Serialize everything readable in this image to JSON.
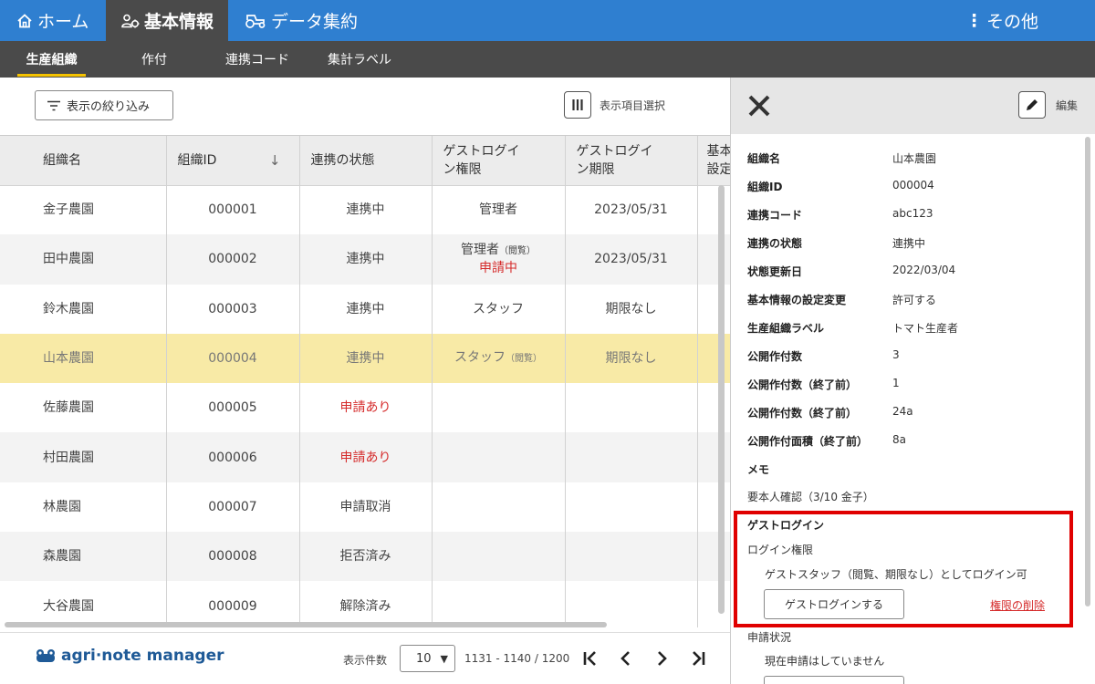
{
  "nav": {
    "home": "ホーム",
    "basic_info": "基本情報",
    "data_aggregation": "データ集約",
    "more": "その他"
  },
  "subnav": {
    "items": [
      "生産組織",
      "作付",
      "連携コード",
      "集計ラベル"
    ],
    "active_index": 0
  },
  "toolbar": {
    "filter_label": "表示の絞り込み",
    "column_select_label": "表示項目選択"
  },
  "table": {
    "headers": [
      "組織名",
      "組織ID",
      "連携の状態",
      "ゲストログイン権限",
      "ゲストログイン期限",
      "基本情報の設定"
    ],
    "header_lines": [
      [
        "組織名"
      ],
      [
        "組織ID"
      ],
      [
        "連携の状態"
      ],
      [
        "ゲストログイ",
        "ン権限"
      ],
      [
        "ゲストログイ",
        "ン期限"
      ],
      [
        "基本",
        "設定"
      ]
    ],
    "sort_indicator": "↓",
    "rows": [
      {
        "name": "金子農園",
        "id": "000001",
        "status": "連携中",
        "status_red": false,
        "perm": "管理者",
        "perm_note": "",
        "perm_extra": "",
        "expiry": "2023/05/31"
      },
      {
        "name": "田中農園",
        "id": "000002",
        "status": "連携中",
        "status_red": false,
        "perm": "管理者",
        "perm_note": "（閲覧）",
        "perm_extra": "申請中",
        "expiry": "2023/05/31"
      },
      {
        "name": "鈴木農園",
        "id": "000003",
        "status": "連携中",
        "status_red": false,
        "perm": "スタッフ",
        "perm_note": "",
        "perm_extra": "",
        "expiry": "期限なし"
      },
      {
        "name": "山本農園",
        "id": "000004",
        "status": "連携中",
        "status_red": false,
        "perm": "スタッフ",
        "perm_note": "（閲覧）",
        "perm_extra": "",
        "expiry": "期限なし",
        "selected": true
      },
      {
        "name": "佐藤農園",
        "id": "000005",
        "status": "申請あり",
        "status_red": true,
        "perm": "",
        "perm_note": "",
        "perm_extra": "",
        "expiry": ""
      },
      {
        "name": "村田農園",
        "id": "000006",
        "status": "申請あり",
        "status_red": true,
        "perm": "",
        "perm_note": "",
        "perm_extra": "",
        "expiry": ""
      },
      {
        "name": "林農園",
        "id": "000007",
        "status": "申請取消",
        "status_red": false,
        "perm": "",
        "perm_note": "",
        "perm_extra": "",
        "expiry": ""
      },
      {
        "name": "森農園",
        "id": "000008",
        "status": "拒否済み",
        "status_red": false,
        "perm": "",
        "perm_note": "",
        "perm_extra": "",
        "expiry": ""
      },
      {
        "name": "大谷農園",
        "id": "000009",
        "status": "解除済み",
        "status_red": false,
        "perm": "",
        "perm_note": "",
        "perm_extra": "",
        "expiry": ""
      }
    ]
  },
  "footer": {
    "brand": "agri·note manager",
    "page_size_label": "表示件数",
    "page_size": "10",
    "range": "1131 - 1140 / 1200"
  },
  "panel": {
    "edit_label": "編集",
    "fields": [
      {
        "label": "組織名",
        "value": "山本農園"
      },
      {
        "label": "組織ID",
        "value": "000004"
      },
      {
        "label": "連携コード",
        "value": "abc123"
      },
      {
        "label": "連携の状態",
        "value": "連携中"
      },
      {
        "label": "状態更新日",
        "value": "2022/03/04"
      },
      {
        "label": "基本情報の設定変更",
        "value": "許可する"
      },
      {
        "label": "生産組織ラベル",
        "value": "トマト生産者"
      },
      {
        "label": "公開作付数",
        "value": "3"
      },
      {
        "label": "公開作付数（終了前）",
        "value": "1"
      },
      {
        "label": "公開作付数（終了前）",
        "value": "24a"
      },
      {
        "label": "公開作付面積（終了前）",
        "value": "8a"
      }
    ],
    "memo_label": "メモ",
    "memo_text": "要本人確認（3/10 金子）",
    "guest": {
      "title": "ゲストログイン",
      "subtitle": "ログイン権限",
      "description": "ゲストスタッフ（閲覧、期限なし）としてログイン可",
      "login_button": "ゲストログインする",
      "remove_link": "権限の削除"
    },
    "request": {
      "title": "申請状況",
      "text": "現在申請はしていません"
    }
  },
  "colors": {
    "nav_blue": "#2f7fd0",
    "nav_dark": "#4a4a4a",
    "accent_yellow": "#f5c200",
    "selected_row": "#f8eaa6",
    "alert_red": "#d52b2b",
    "highlight_box": "#e00000"
  }
}
